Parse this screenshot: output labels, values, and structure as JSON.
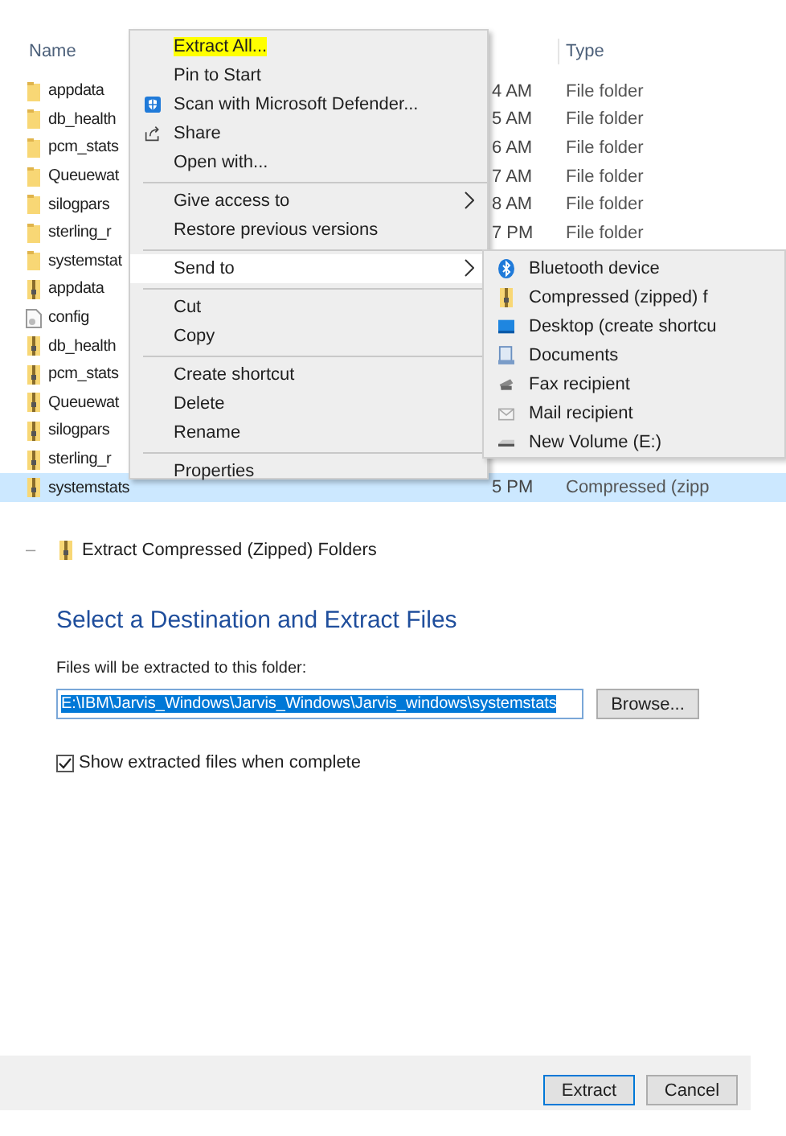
{
  "explorer": {
    "columns": {
      "name": "Name",
      "type": "Type"
    },
    "rows": [
      {
        "kind": "folder",
        "name": "appdata",
        "date": "4 AM",
        "type": "File folder",
        "selected": false
      },
      {
        "kind": "folder",
        "name": "db_health",
        "date": "5 AM",
        "type": "File folder",
        "selected": false
      },
      {
        "kind": "folder",
        "name": "pcm_stats",
        "date": "6 AM",
        "type": "File folder",
        "selected": false
      },
      {
        "kind": "folder",
        "name": "Queuewat",
        "date": "7 AM",
        "type": "File folder",
        "selected": false
      },
      {
        "kind": "folder",
        "name": "silogpars",
        "date": "8 AM",
        "type": "File folder",
        "selected": false
      },
      {
        "kind": "folder",
        "name": "sterling_r",
        "date": "7 PM",
        "type": "File folder",
        "selected": false
      },
      {
        "kind": "folder",
        "name": "systemstat",
        "selected": false
      },
      {
        "kind": "zip",
        "name": "appdata",
        "selected": false
      },
      {
        "kind": "file",
        "name": "config",
        "selected": false
      },
      {
        "kind": "zip",
        "name": "db_health",
        "selected": false
      },
      {
        "kind": "zip",
        "name": "pcm_stats",
        "selected": false
      },
      {
        "kind": "zip",
        "name": "Queuewat",
        "selected": false
      },
      {
        "kind": "zip",
        "name": "silogpars",
        "selected": false
      },
      {
        "kind": "zip",
        "name": "sterling_r",
        "selected": false
      },
      {
        "kind": "zip",
        "name": "systemstats",
        "date": "5 PM",
        "type": "Compressed (zipp",
        "selected": true
      }
    ]
  },
  "context_menu": {
    "groups": [
      [
        {
          "label": "Extract All...",
          "marked": true,
          "submenu": false,
          "selected": false
        },
        {
          "label": "Pin to Start",
          "submenu": false,
          "selected": false
        },
        {
          "kind": "shield",
          "label": "Scan with Microsoft Defender...",
          "submenu": false,
          "selected": false
        },
        {
          "kind": "share",
          "label": "Share",
          "submenu": false,
          "selected": false
        },
        {
          "label": "Open with...",
          "submenu": false,
          "selected": false
        }
      ],
      [
        {
          "label": "Give access to",
          "submenu": true,
          "selected": false
        },
        {
          "label": "Restore previous versions",
          "submenu": false,
          "selected": false
        }
      ],
      [
        {
          "label": "Send to",
          "submenu": true,
          "selected": true
        }
      ],
      [
        {
          "label": "Cut",
          "submenu": false,
          "selected": false
        },
        {
          "label": "Copy",
          "submenu": false,
          "selected": false
        }
      ],
      [
        {
          "label": "Create shortcut",
          "submenu": false,
          "selected": false
        },
        {
          "label": "Delete",
          "submenu": false,
          "selected": false
        },
        {
          "label": "Rename",
          "submenu": false,
          "selected": false
        }
      ],
      [
        {
          "label": "Properties",
          "submenu": false,
          "selected": false
        }
      ]
    ]
  },
  "send_to_menu": [
    {
      "kind": "bluetooth",
      "label": "Bluetooth device"
    },
    {
      "kind": "zip",
      "label": "Compressed (zipped) f"
    },
    {
      "kind": "desktop",
      "label": "Desktop (create shortcu"
    },
    {
      "kind": "documents",
      "label": "Documents"
    },
    {
      "kind": "fax",
      "label": "Fax recipient"
    },
    {
      "kind": "mail",
      "label": "Mail recipient"
    },
    {
      "kind": "drive",
      "label": "New Volume (E:)"
    }
  ],
  "dialog": {
    "minimize": "–",
    "title": "Extract Compressed (Zipped) Folders",
    "heading": "Select a Destination and Extract Files",
    "path_label": "Files will be extracted to this folder:",
    "path": {
      "value": "E:\\IBM\\Jarvis_Windows\\Jarvis_Windows\\Jarvis_windows\\systemstats",
      "text_selected": true
    },
    "browse": "Browse...",
    "show_files": {
      "label": "Show extracted files when complete",
      "checked": true
    },
    "buttons": [
      {
        "label": "Extract",
        "default": true
      },
      {
        "label": "Cancel",
        "default": false
      }
    ]
  }
}
